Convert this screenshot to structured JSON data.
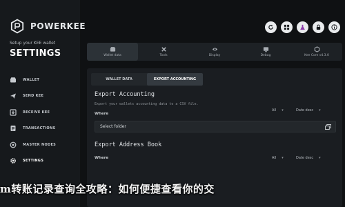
{
  "sidebar": {
    "logo_text": "POWERKEE",
    "setup_line": "Setup your KEE wallet",
    "title": "SETTINGS",
    "items": [
      {
        "label": "WALLET",
        "icon": "wallet-icon"
      },
      {
        "label": "SEND KEE",
        "icon": "send-icon"
      },
      {
        "label": "RECEIVE KEE",
        "icon": "receive-icon"
      },
      {
        "label": "TRANSACTIONS",
        "icon": "transactions-icon"
      },
      {
        "label": "MASTER NODES",
        "icon": "master-nodes-icon"
      },
      {
        "label": "SETTINGS",
        "icon": "settings-icon",
        "active": true
      }
    ]
  },
  "topbar": {
    "buttons": [
      "refresh-icon",
      "grid-icon",
      "flask-icon",
      "lock-icon",
      "info-icon"
    ]
  },
  "tabs": [
    {
      "label": "Wallet data",
      "icon": "wallet-data-icon",
      "active": true
    },
    {
      "label": "Tools",
      "icon": "tools-icon"
    },
    {
      "label": "Display",
      "icon": "display-icon"
    },
    {
      "label": "Debug",
      "icon": "debug-icon"
    },
    {
      "label": "Kee Core v4.3.0",
      "icon": "kee-core-icon"
    }
  ],
  "subtabs": [
    {
      "label": "WALLET DATA",
      "active": false
    },
    {
      "label": "EXPORT ACCOUNTING",
      "active": true
    }
  ],
  "export_accounting": {
    "title": "Export Accounting",
    "description": "Export your wallets accounting data to a CSV file.",
    "where_label": "Where",
    "filter_value": "All",
    "sort_value": "Date desc",
    "field_value": "Select folder"
  },
  "export_address_book": {
    "title": "Export Address Book",
    "where_label": "Where",
    "filter_value": "All",
    "sort_value": "Date desc"
  },
  "headline": "m转账记录查询全攻略：如何便捷查看你的交",
  "colors": {
    "background": "#0f1113",
    "sidebar": "#16191c",
    "panel": "#1a1d21",
    "accent": "#e9ebed"
  }
}
